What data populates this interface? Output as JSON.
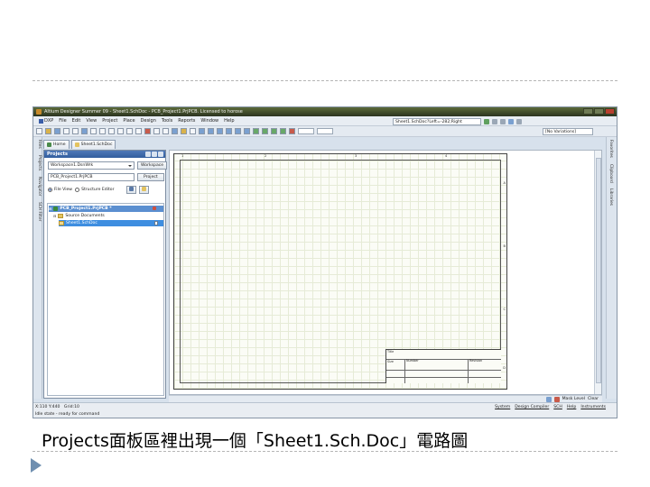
{
  "app": {
    "title": "Altium Designer Summer 09 - Sheet1.SchDoc - PCB_Project1.PrjPCB. Licensed to horose"
  },
  "menu": {
    "dxp": "DXP",
    "items": [
      "File",
      "Edit",
      "View",
      "Project",
      "Place",
      "Design",
      "Tools",
      "Reports",
      "Window",
      "Help"
    ],
    "doc_path": "Sheet1.SchDoc?Left=-282;Right"
  },
  "toolbar": {
    "variations": "[No Variations]"
  },
  "side_tabs": {
    "left": [
      "Files",
      "Projects",
      "Navigator",
      "SCH Filter"
    ],
    "right": [
      "Favorites",
      "Clipboard",
      "Libraries"
    ]
  },
  "doc_tabs": {
    "home": "Home",
    "sheet": "Sheet1.SchDoc"
  },
  "projects_panel": {
    "title": "Projects",
    "workspace_value": "Workspace1.DsnWrk",
    "workspace_button": "Workspace",
    "project_value": "PCB_Project1.PrjPCB",
    "project_button": "Project",
    "view_file": "File View",
    "view_structure": "Structure Editor",
    "tree": {
      "project": "PCB_Project1.PrjPCB *",
      "folder": "Source Documents",
      "doc": "Sheet1.SchDoc"
    }
  },
  "sheet": {
    "zones_top": [
      "1",
      "2",
      "3",
      "4"
    ],
    "zones_side": [
      "A",
      "B",
      "C",
      "D"
    ],
    "title_block": {
      "title": "Title",
      "size": "Size",
      "number": "Number",
      "revision": "Revision"
    }
  },
  "bottom": {
    "mask_level": "Mask Level",
    "clear": "Clear"
  },
  "status": {
    "coords": "X:110 Y:440",
    "grid": "Grid:10",
    "state": "Idle state - ready for command",
    "panels": [
      "System",
      "Design Compiler",
      "SCH",
      "Help",
      "Instruments"
    ]
  },
  "caption": "Projects面板區裡出現一個「Sheet1.Sch.Doc」電路圖"
}
